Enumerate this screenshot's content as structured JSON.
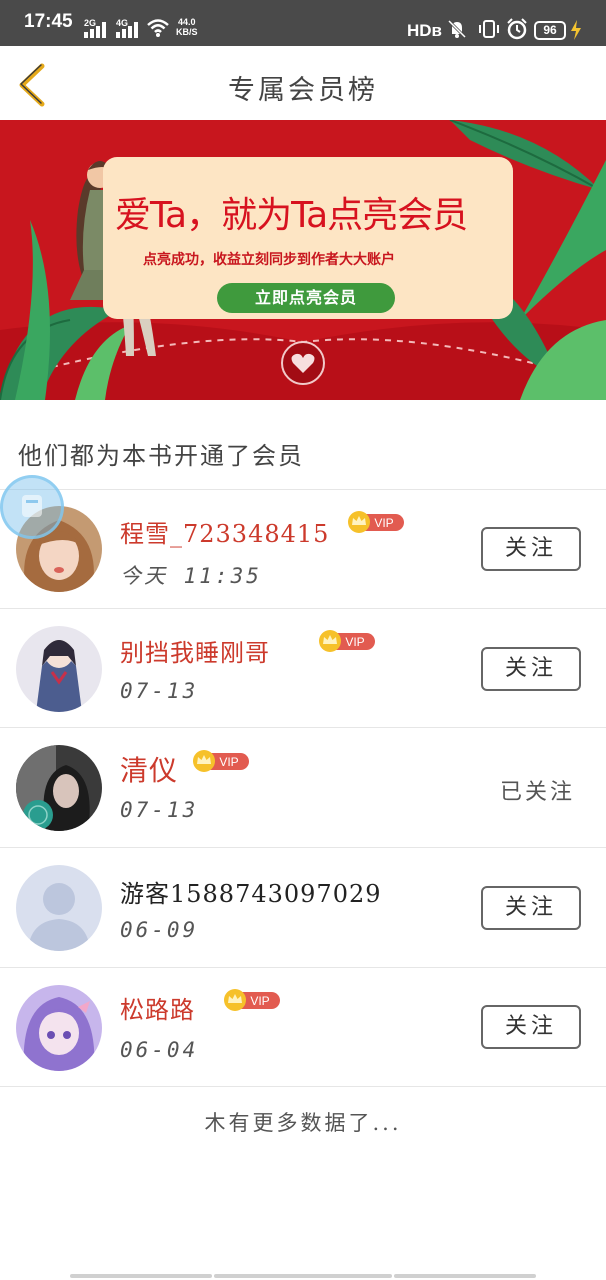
{
  "status_bar": {
    "time": "17:45",
    "net1": "2G",
    "net2": "4G",
    "speed_value": "44.0",
    "speed_unit": "KB/S",
    "hd": "HDв",
    "battery": "96"
  },
  "header": {
    "title": "专属会员榜"
  },
  "banner": {
    "headline": "爱Ta，就为Ta点亮会员",
    "subtitle": "点亮成功，收益立刻同步到作者大大账户",
    "button": "立即点亮会员"
  },
  "section_label": "他们都为本书开通了会员",
  "vip_label": "VIP",
  "members": [
    {
      "name": "程雪_723348415",
      "date": "今天 11:35",
      "vip": true,
      "action": "关注",
      "followed": false
    },
    {
      "name": "别挡我睡刚哥",
      "date": "07-13",
      "vip": true,
      "action": "关注",
      "followed": false
    },
    {
      "name": "清仪",
      "date": "07-13",
      "vip": true,
      "action": "已关注",
      "followed": true
    },
    {
      "name": "游客1588743097029",
      "date": "06-09",
      "vip": false,
      "action": "关注",
      "followed": false
    },
    {
      "name": "松路路",
      "date": "06-04",
      "vip": true,
      "action": "关注",
      "followed": false
    }
  ],
  "footer_note": "木有更多数据了...",
  "colors": {
    "banner_red": "#c8161e",
    "card_cream": "#fde5c4",
    "button_green": "#3f9a3d",
    "vip_name": "#cc3a2c",
    "back_arrow": "#e5a91a"
  },
  "icons": {
    "back": "chevron-left-icon",
    "crown": "crown-icon",
    "floating": "floating-bubble-icon"
  }
}
